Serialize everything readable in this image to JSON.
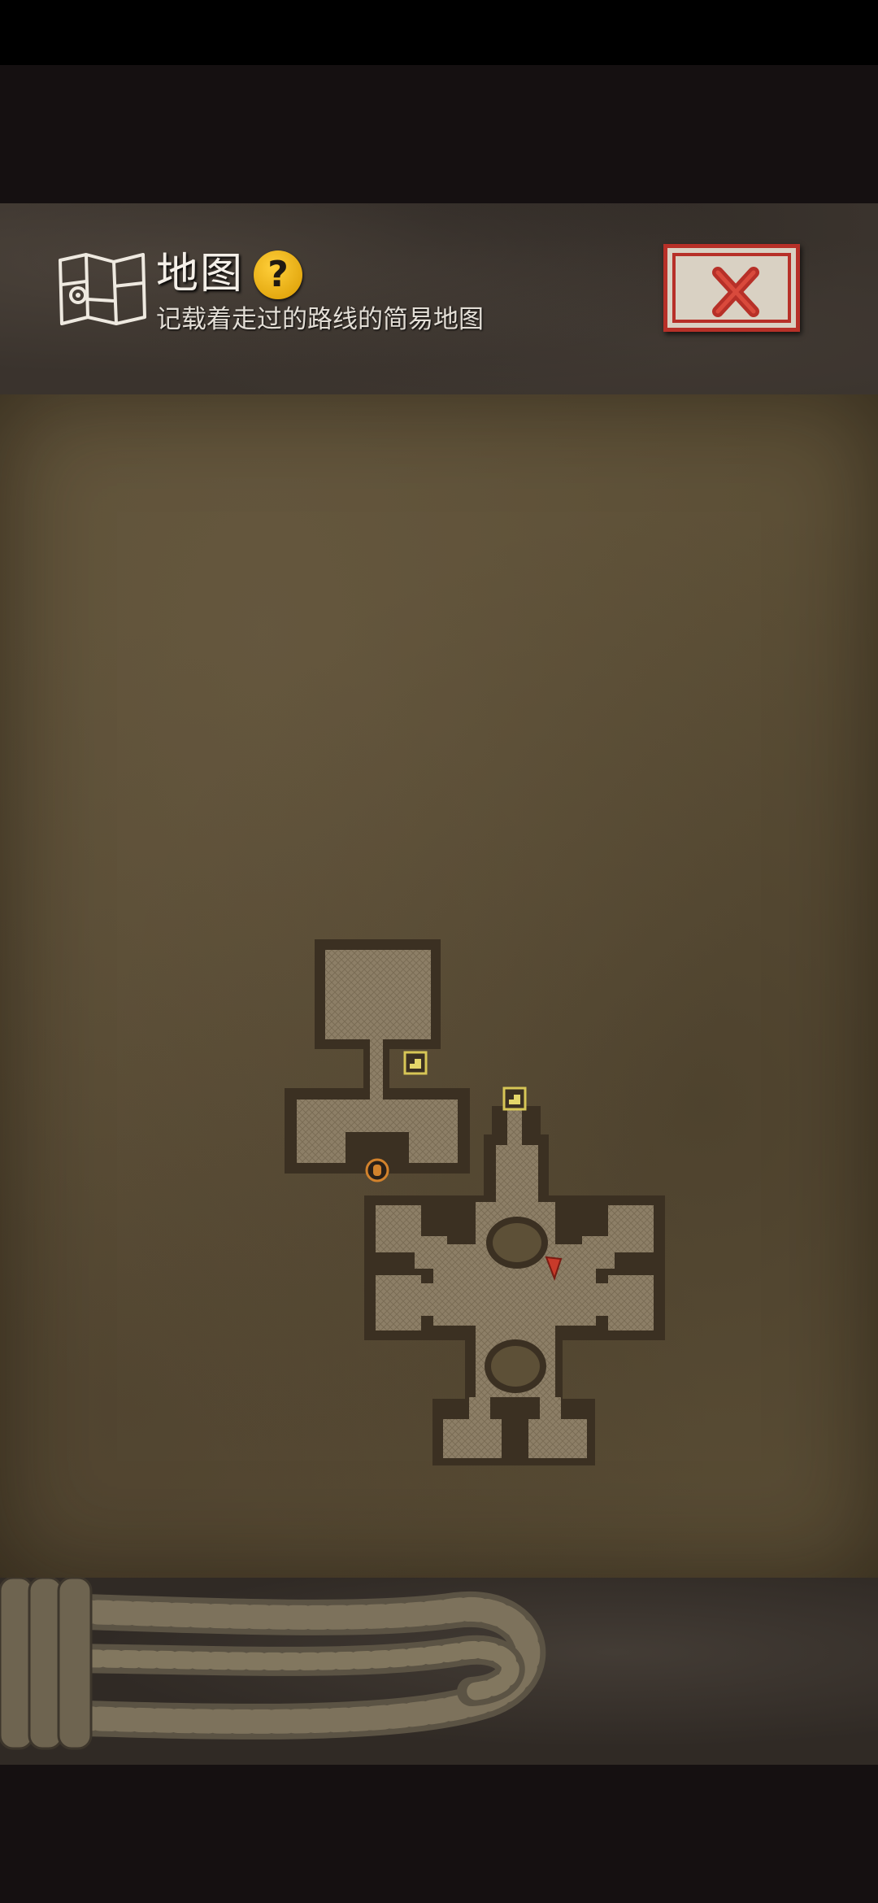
{
  "header": {
    "title": "地图",
    "subtitle": "记载着走过的路线的简易地图",
    "icons": {
      "map": "map-icon",
      "help": "question-mark-icon",
      "close": "close-x-icon"
    },
    "help_glyph": "?"
  },
  "map": {
    "markers": [
      "stairs-icon",
      "stairs-icon",
      "door-icon",
      "player-arrow-icon"
    ]
  },
  "colors": {
    "parchment": "#5d5037",
    "room_floor": "#8b7d65",
    "room_outline": "#3b3022",
    "close_red": "#b73028",
    "help_yellow": "#f2b418"
  }
}
